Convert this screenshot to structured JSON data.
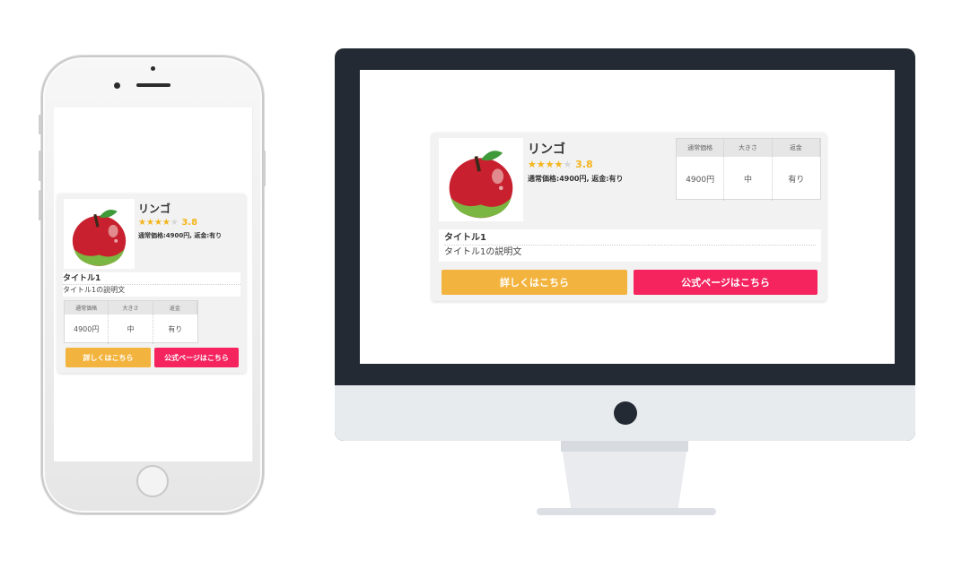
{
  "product": {
    "name": "リンゴ",
    "rating_value": "3.8",
    "stars_filled": "★★★★",
    "stars_empty": "★",
    "meta": "通常価格:4900円, 返金:有り",
    "image_icon": "apple-icon"
  },
  "description": {
    "title": "タイトル1",
    "text": "タイトル1の説明文"
  },
  "spec": {
    "headers": [
      "通常価格",
      "大きさ",
      "返金"
    ],
    "values": [
      "4900円",
      "中",
      "有り"
    ]
  },
  "buttons": {
    "detail_label": "詳しくはこちら",
    "official_label": "公式ページはこちら"
  },
  "colors": {
    "detail_button": "#f3b43f",
    "official_button": "#f5245f",
    "star": "#f4b41a",
    "monitor_frame": "#232a33"
  }
}
